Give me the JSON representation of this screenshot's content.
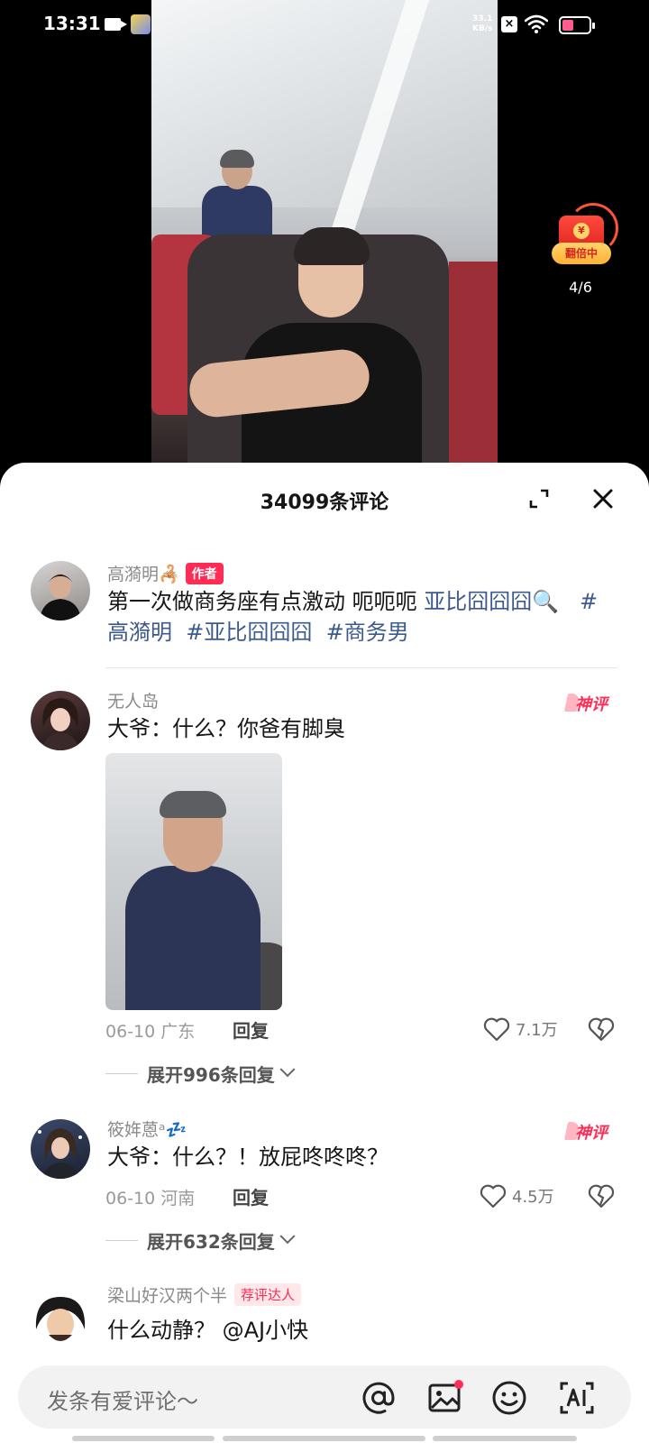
{
  "status_bar": {
    "time": "13:31",
    "speed_value": "33.1",
    "speed_unit": "KB/s"
  },
  "video": {
    "red_packet_label": "翻倍中",
    "red_packet_count": "4/6"
  },
  "comments_panel": {
    "title": "34099条评论"
  },
  "comments": [
    {
      "username": "高漪明🦂",
      "badge": "作者",
      "text_plain": "第一次做商务座有点激动 呃呃呃 ",
      "text_link": "亚比囧囧囧🔍",
      "hashtags": [
        "#高漪明",
        "#亚比囧囧囧",
        "#商务男"
      ]
    },
    {
      "username": "无人岛",
      "award": "神评",
      "text": "大爷：什么？你爸有脚臭",
      "date_location": "06-10 广东",
      "reply_label": "回复",
      "likes": "7.1万",
      "expand_replies": "展开996条回复"
    },
    {
      "username": "筱姩蒽ᵃ💤",
      "award": "神评",
      "text": "大爷：什么？！放屁咚咚咚？",
      "date_location": "06-10 河南",
      "reply_label": "回复",
      "likes": "4.5万",
      "expand_replies": "展开632条回复"
    },
    {
      "username": "梁山好汉两个半",
      "badge": "荐评达人",
      "text": "什么动静？ @AJ小快"
    }
  ],
  "input_bar": {
    "placeholder": "发条有爱评论～"
  },
  "icons": {
    "expand": "expand-icon",
    "close": "close-icon",
    "like": "heart-icon",
    "dislike": "broken-heart-icon",
    "mention": "at-icon",
    "image": "image-icon",
    "emoji": "emoji-icon",
    "ai": "ai-icon"
  },
  "colors": {
    "accent": "#ff2c55",
    "hashtag": "#3d5a8f"
  }
}
